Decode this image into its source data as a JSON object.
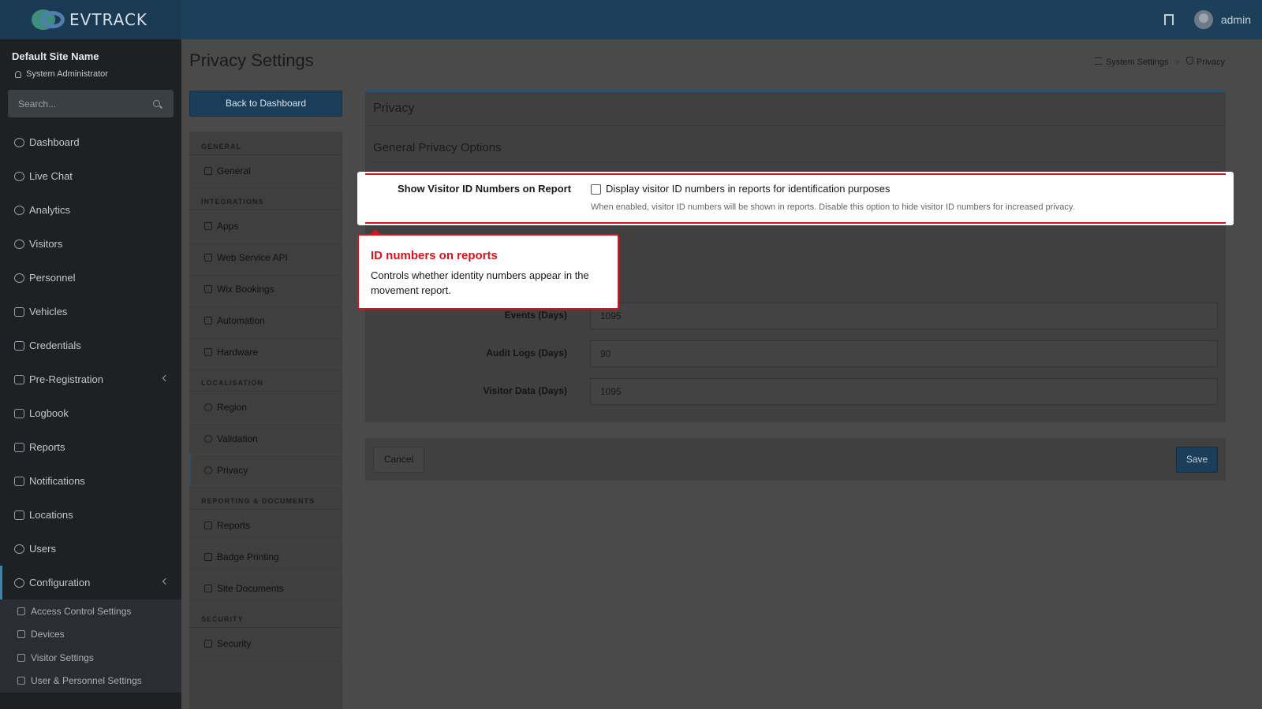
{
  "header": {
    "brand": "EVTRACK",
    "user_name": "admin"
  },
  "sidebar": {
    "site_name": "Default Site Name",
    "role": "System Administrator",
    "search_placeholder": "Search...",
    "items": [
      {
        "label": "Dashboard",
        "icon": "dashboard-icon"
      },
      {
        "label": "Live Chat",
        "icon": "headset-icon"
      },
      {
        "label": "Analytics",
        "icon": "analytics-icon"
      },
      {
        "label": "Visitors",
        "icon": "eye-icon"
      },
      {
        "label": "Personnel",
        "icon": "personnel-icon"
      },
      {
        "label": "Vehicles",
        "icon": "car-icon"
      },
      {
        "label": "Credentials",
        "icon": "id-card-icon"
      },
      {
        "label": "Pre-Registration",
        "icon": "arrows-icon"
      },
      {
        "label": "Logbook",
        "icon": "book-icon"
      },
      {
        "label": "Reports",
        "icon": "reports-icon"
      },
      {
        "label": "Notifications",
        "icon": "bell-icon"
      },
      {
        "label": "Locations",
        "icon": "map-icon"
      },
      {
        "label": "Users",
        "icon": "users-icon"
      },
      {
        "label": "Configuration",
        "icon": "gear-icon"
      }
    ],
    "sub_items": [
      {
        "label": "Access Control Settings",
        "icon": "lock-icon"
      },
      {
        "label": "Devices",
        "icon": "device-icon"
      },
      {
        "label": "Visitor Settings",
        "icon": "eye-icon"
      },
      {
        "label": "User & Personnel Settings",
        "icon": "user-settings-icon"
      }
    ]
  },
  "page": {
    "title": "Privacy Settings",
    "breadcrumb": [
      "System Settings",
      ">",
      "Privacy"
    ],
    "back_button": "Back to Dashboard"
  },
  "settings_nav": {
    "sections": [
      {
        "heading": "GENERAL",
        "items": [
          "General"
        ]
      },
      {
        "heading": "INTEGRATIONS",
        "items": [
          "Apps",
          "Web Service API",
          "Wix Bookings",
          "Automation",
          "Hardware"
        ]
      },
      {
        "heading": "LOCALISATION",
        "items": [
          "Region",
          "Validation",
          "Privacy"
        ]
      },
      {
        "heading": "REPORTING & DOCUMENTS",
        "items": [
          "Reports",
          "Badge Printing",
          "Site Documents"
        ]
      },
      {
        "heading": "SECURITY",
        "items": [
          "Security"
        ]
      }
    ]
  },
  "panel": {
    "title": "Privacy",
    "section_title": "General Privacy Options",
    "highlight": {
      "label": "Show Visitor ID Numbers on Report",
      "checkbox_label": "Display visitor ID numbers in reports for identification purposes",
      "help": "When enabled, visitor ID numbers will be shown in reports. Disable this option to hide visitor ID numbers for increased privacy."
    },
    "retention": [
      {
        "label": "Events (Days)",
        "value": "1095"
      },
      {
        "label": "Audit Logs (Days)",
        "value": "90"
      },
      {
        "label": "Visitor Data (Days)",
        "value": "1095"
      }
    ]
  },
  "footer": {
    "cancel": "Cancel",
    "save": "Save"
  },
  "callout": {
    "title": "ID numbers on reports",
    "body": "Controls whether identity numbers appear in the movement report."
  },
  "colors": {
    "accent": "#1b3f5b",
    "highlight": "#e0101a"
  }
}
